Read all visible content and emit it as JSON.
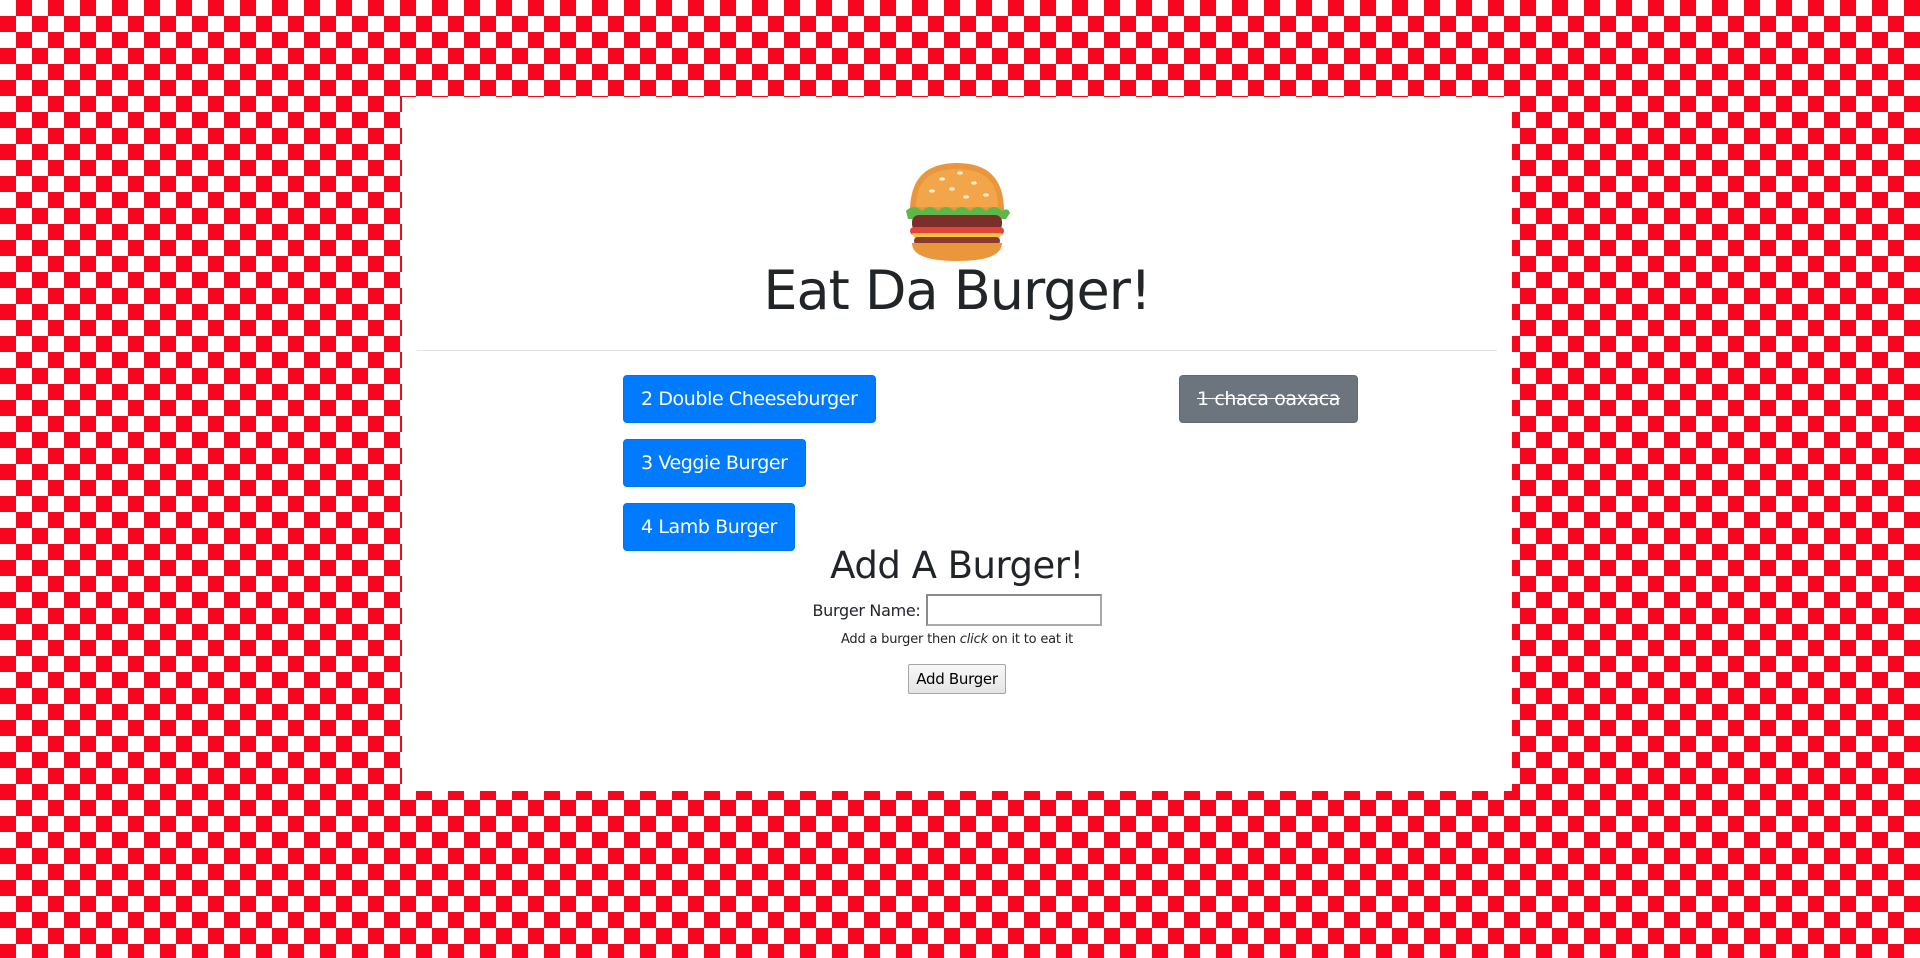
{
  "header": {
    "logo_icon": "hamburger-icon",
    "title": "Eat Da Burger!"
  },
  "burgers": {
    "not_devoured": [
      {
        "label": "2 Double Cheeseburger"
      },
      {
        "label": "3 Veggie Burger"
      },
      {
        "label": "4 Lamb Burger"
      }
    ],
    "devoured": [
      {
        "label": "1 chaca oaxaca"
      }
    ]
  },
  "add_form": {
    "title": "Add A Burger!",
    "name_label": "Burger Name:",
    "name_value": "",
    "hint_before": "Add a burger then ",
    "hint_emphasis": "click",
    "hint_after": " on it to eat it",
    "submit_label": "Add Burger"
  },
  "colors": {
    "background_check_red": "#f8061d",
    "primary_button": "#007bff",
    "devoured_button": "#6c757d"
  }
}
